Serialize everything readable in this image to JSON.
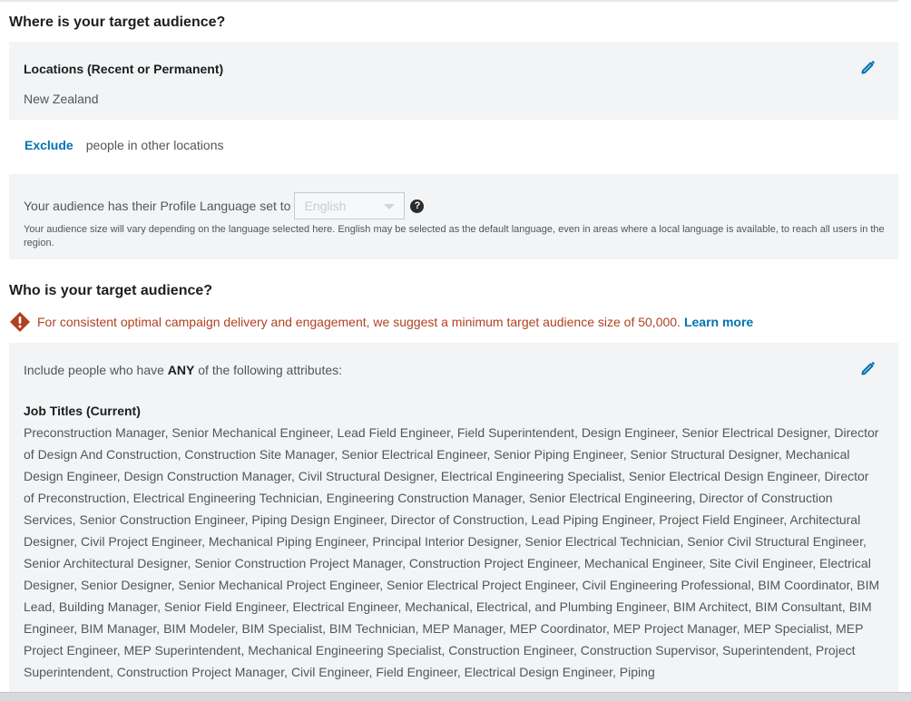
{
  "where": {
    "title": "Where is your target audience?",
    "locations_label": "Locations (Recent or Permanent)",
    "locations_value": "New Zealand",
    "exclude_link": "Exclude",
    "exclude_text": "people in other locations"
  },
  "language": {
    "label": "Your audience has their Profile Language set to",
    "selected": "English",
    "note": "Your audience size will vary depending on the language selected here. English may be selected as the default language, even in areas where a local language is available, to reach all users in the region."
  },
  "who": {
    "title": "Who is your target audience?",
    "warning": "For consistent optimal campaign delivery and engagement, we suggest a minimum target audience size of 50,000.",
    "learn_more": "Learn more",
    "include_prefix": "Include people who have",
    "include_any": "ANY",
    "include_suffix": "of the following attributes:",
    "job_titles_label": "Job Titles (Current)",
    "job_titles_text": "Preconstruction Manager, Senior Mechanical Engineer, Lead Field Engineer, Field Superintendent, Design Engineer, Senior Electrical Designer, Director of Design And Construction, Construction Site Manager, Senior Electrical Engineer, Senior Piping Engineer, Senior Structural Designer, Mechanical Design Engineer, Design Construction Manager, Civil Structural Designer, Electrical Engineering Specialist, Senior Electrical Design Engineer, Director of Preconstruction, Electrical Engineering Technician, Engineering Construction Manager, Senior Electrical Engineering, Director of Construction Services, Senior Construction Engineer, Piping Design Engineer, Director of Construction, Lead Piping Engineer, Project Field Engineer, Architectural Designer, Civil Project Engineer, Mechanical Piping Engineer, Principal Interior Designer, Senior Electrical Technician, Senior Civil Structural Engineer, Senior Architectural Designer, Senior Construction Project Manager, Construction Project Engineer, Mechanical Engineer, Site Civil Engineer, Electrical Designer, Senior Designer, Senior Mechanical Project Engineer, Senior Electrical Project Engineer, Civil Engineering Professional, BIM Coordinator, BIM Lead, Building Manager, Senior Field Engineer, Electrical Engineer, Mechanical, Electrical, and Plumbing Engineer, BIM Architect, BIM Consultant, BIM Engineer, BIM Manager, BIM Modeler, BIM Specialist, BIM Technician, MEP Manager, MEP Coordinator, MEP Project Manager, MEP Specialist, MEP Project Engineer, MEP Superintendent, Mechanical Engineering Specialist, Construction Engineer, Construction Supervisor, Superintendent, Project Superintendent, Construction Project Manager, Civil Engineer, Field Engineer, Electrical Design Engineer, Piping"
  },
  "icons": {
    "edit": "pencil-icon",
    "help": "question-icon",
    "warning": "warning-diamond-icon"
  },
  "colors": {
    "link": "#0073b1",
    "warning": "#b24020",
    "panel": "#f2f4f6"
  }
}
